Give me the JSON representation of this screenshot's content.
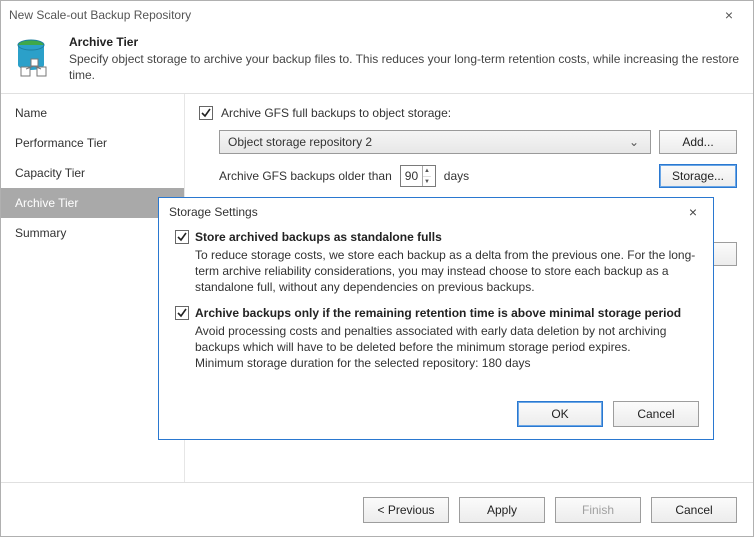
{
  "window": {
    "title": "New Scale-out Backup Repository"
  },
  "header": {
    "title": "Archive Tier",
    "subtitle": "Specify object storage to archive your backup files to. This reduces your long-term retention costs, while increasing the restore time."
  },
  "nav": {
    "items": [
      {
        "label": "Name"
      },
      {
        "label": "Performance Tier"
      },
      {
        "label": "Capacity Tier"
      },
      {
        "label": "Archive Tier"
      },
      {
        "label": "Summary"
      }
    ],
    "selectedIndex": 3
  },
  "content": {
    "archive_check_label": "Archive GFS full backups to object storage:",
    "repo_selected": "Object storage repository 2",
    "add_label": "Add...",
    "older_prefix": "Archive GFS backups older than",
    "older_value": "90",
    "older_suffix": "days",
    "storage_label": "Storage...",
    "add2_label": "Add..."
  },
  "footer": {
    "previous": "< Previous",
    "apply": "Apply",
    "finish": "Finish",
    "cancel": "Cancel"
  },
  "modal": {
    "title": "Storage Settings",
    "ok": "OK",
    "cancel": "Cancel",
    "opt1": {
      "label": "Store archived backups as standalone fulls",
      "desc": "To reduce storage costs, we store each backup as a delta from the previous one. For the long-term archive reliability considerations, you may instead choose to store each backup as a standalone full, without any dependencies on previous backups."
    },
    "opt2": {
      "label": "Archive backups only if the remaining retention time is above minimal storage period",
      "desc": "Avoid processing costs and penalties associated with early data deletion by not archiving backups which will have to be deleted before the minimum storage period expires.",
      "note": "Minimum storage duration for the selected repository: 180 days"
    }
  }
}
